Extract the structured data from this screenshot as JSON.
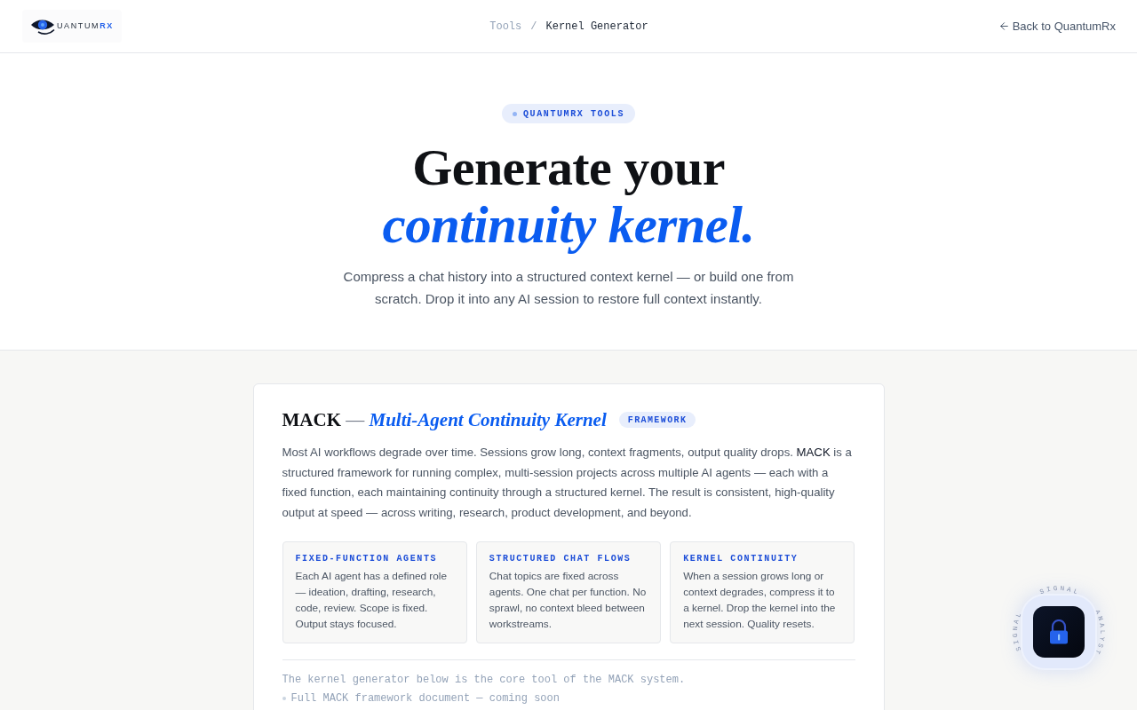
{
  "header": {
    "logo": {
      "text": "UANTUM",
      "accent": "RX"
    },
    "breadcrumb": {
      "separator": "/",
      "items": [
        {
          "label": "Tools",
          "current": false
        },
        {
          "label": "Kernel Generator",
          "current": true
        }
      ]
    },
    "back_link": "Back to QuantumRx"
  },
  "hero": {
    "badge": "QUANTUMRX TOOLS",
    "title": "Generate your",
    "title_accent": "continuity kernel.",
    "subtitle": "Compress a chat history into a structured context kernel — or build one from scratch. Drop it into any AI session to restore full context instantly."
  },
  "framework_card": {
    "title": "MACK",
    "separator": "—",
    "title_accent": "Multi-Agent Continuity Kernel",
    "badge": "FRAMEWORK",
    "description": "Most AI workflows degrade over time. Sessions grow long, context fragments, output quality drops. **MACK** is a structured framework for running complex, multi-session projects across multiple AI agents — each with a fixed function, each maintaining continuity through a structured kernel. The result is consistent, high-quality output at speed — across writing, research, product development, and beyond.",
    "features": [
      {
        "title": "FIXED-FUNCTION AGENTS",
        "body": "Each AI agent has a defined role — ideation, drafting, research, code, review. Scope is fixed. Output stays focused."
      },
      {
        "title": "STRUCTURED CHAT FLOWS",
        "body": "Chat topics are fixed across agents. One chat per function. No sprawl, no context bleed between workstreams."
      },
      {
        "title": "KERNEL CONTINUITY",
        "body": "When a session grows long or context degrades, compress it to a kernel. Drop the kernel into the next session. Quality resets."
      }
    ],
    "note": "The kernel generator below is the core tool of the MACK system.",
    "links": [
      "Full MACK framework document — coming soon"
    ]
  },
  "assistant_widget": {
    "orbit_words": [
      "SIGNAL",
      "SIGNAL",
      "ANALYST"
    ]
  }
}
